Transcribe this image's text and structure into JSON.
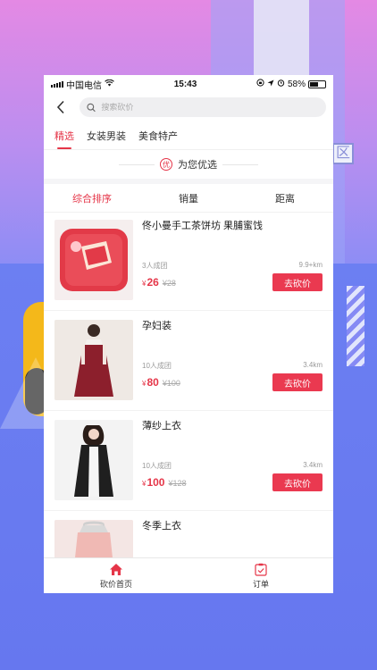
{
  "status_bar": {
    "carrier": "中国电信",
    "time": "15:43",
    "battery": "58%"
  },
  "search": {
    "placeholder": "搜索砍价"
  },
  "category_tabs": [
    {
      "label": "精选",
      "active": true
    },
    {
      "label": "女装男装",
      "active": false
    },
    {
      "label": "美食特产",
      "active": false
    }
  ],
  "section": {
    "badge": "优",
    "title": "为您优选"
  },
  "sort_options": [
    {
      "label": "综合排序",
      "active": true
    },
    {
      "label": "销量",
      "active": false
    },
    {
      "label": "距离",
      "active": false
    }
  ],
  "products": [
    {
      "name": "佟小曼手工茶饼坊 果脯蜜饯",
      "group": "3人成团",
      "distance": "9.9+km",
      "currency": "¥",
      "price": "26",
      "original": "¥28",
      "action": "去砍价",
      "thumb_color": "#e8434f"
    },
    {
      "name": "孕妇装",
      "group": "10人成团",
      "distance": "3.4km",
      "currency": "¥",
      "price": "80",
      "original": "¥100",
      "action": "去砍价",
      "thumb_color": "#8c1f2c"
    },
    {
      "name": "薄纱上衣",
      "group": "10人成团",
      "distance": "3.4km",
      "currency": "¥",
      "price": "100",
      "original": "¥128",
      "action": "去砍价",
      "thumb_color": "#2a2a2a"
    },
    {
      "name": "冬季上衣",
      "group": "",
      "distance": "",
      "currency": "",
      "price": "",
      "original": "",
      "action": "",
      "thumb_color": "#f2c4c0"
    }
  ],
  "bottom_tabs": [
    {
      "label": "砍价首页",
      "icon": "home-icon"
    },
    {
      "label": "订单",
      "icon": "order-icon"
    }
  ],
  "colors": {
    "accent": "#e53548",
    "button": "#ea3950"
  }
}
